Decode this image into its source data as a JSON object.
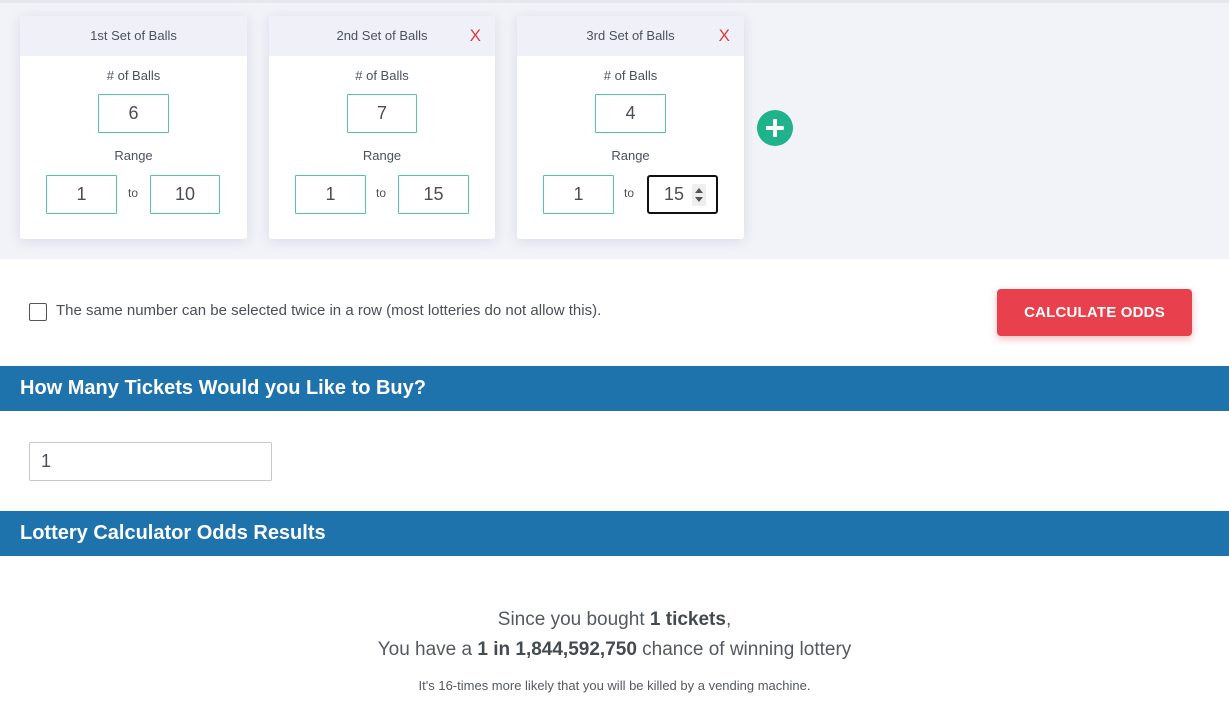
{
  "sets": [
    {
      "title": "1st Set of Balls",
      "close": "",
      "balls_label": "# of Balls",
      "balls": "6",
      "range_label": "Range",
      "range_from": "1",
      "to_label": "to",
      "range_to": "10"
    },
    {
      "title": "2nd Set of Balls",
      "close": "X",
      "balls_label": "# of Balls",
      "balls": "7",
      "range_label": "Range",
      "range_from": "1",
      "to_label": "to",
      "range_to": "15"
    },
    {
      "title": "3rd Set of Balls",
      "close": "X",
      "balls_label": "# of Balls",
      "balls": "4",
      "range_label": "Range",
      "range_from": "1",
      "to_label": "to",
      "range_to": "15"
    }
  ],
  "add_icon": "plus-circle-icon",
  "repeat_option": {
    "label": "The same number can be selected twice in a row (most lotteries do not allow this).",
    "checked": false
  },
  "calculate_button": "CALCULATE ODDS",
  "tickets_section": {
    "title": "How Many Tickets Would you Like to Buy?",
    "value": "1"
  },
  "results_section": {
    "title": "Lottery Calculator Odds Results",
    "line1_prefix": "Since you bought ",
    "line1_bold": "1 tickets",
    "line1_suffix": ",",
    "line2_prefix": "You have a ",
    "line2_bold": "1 in 1,844,592,750",
    "line2_suffix": " chance of winning lottery",
    "note": "It's 16-times more likely that you will be killed by a vending machine."
  },
  "colors": {
    "accent_green": "#20b38b",
    "button_red": "#e8404d",
    "section_blue": "#1f73ac",
    "close_red": "#e0393f"
  }
}
